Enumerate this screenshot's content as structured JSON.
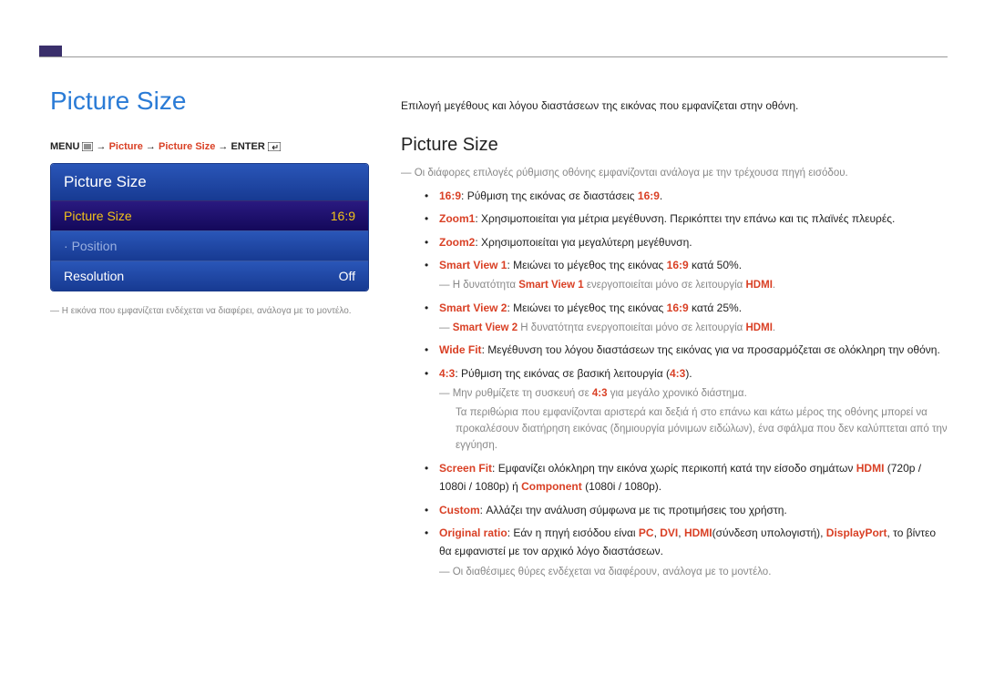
{
  "header": {
    "main_title": "Picture Size"
  },
  "nav": {
    "menu": "MENU",
    "picture": "Picture",
    "picture_size": "Picture Size",
    "enter": "ENTER"
  },
  "osd": {
    "title": "Picture Size",
    "rows": [
      {
        "label": "Picture Size",
        "value": "16:9",
        "selected": true
      },
      {
        "label": "Position",
        "value": "",
        "dot": true,
        "disabled": true
      },
      {
        "label": "Resolution",
        "value": "Off"
      }
    ]
  },
  "left_note": "Η εικόνα που εμφανίζεται ενδέχεται να διαφέρει, ανάλογα με το μοντέλο.",
  "right": {
    "intro": "Επιλογή μεγέθους και λόγου διαστάσεων της εικόνας που εμφανίζεται στην οθόνη.",
    "section_heading": "Picture Size",
    "top_note": "Οι διάφορες επιλογές ρύθμισης οθόνης εμφανίζονται ανάλογα με την τρέχουσα πηγή εισόδου.",
    "items": {
      "i0": {
        "label": "16:9",
        "text": ": Ρύθμιση της εικόνας σε διαστάσεις ",
        "tail": "16:9",
        "end": "."
      },
      "i1": {
        "label": "Zoom1",
        "text": ": Χρησιμοποιείται για μέτρια μεγέθυνση. Περικόπτει την επάνω και τις πλαϊνές πλευρές."
      },
      "i2": {
        "label": "Zoom2",
        "text": ": Χρησιμοποιείται για μεγαλύτερη μεγέθυνση."
      },
      "i3": {
        "label": "Smart View 1",
        "text": ": Μειώνει το μέγεθος της εικόνας ",
        "mid": "16:9",
        "text2": " κατά 50%."
      },
      "i3note": {
        "pre": "Η δυνατότητα ",
        "hl1": "Smart View 1",
        "mid": " ενεργοποιείται μόνο σε λειτουργία ",
        "hl2": "HDMI",
        "end": "."
      },
      "i4": {
        "label": "Smart View 2",
        "text": ": Μειώνει το μέγεθος της εικόνας ",
        "mid": "16:9",
        "text2": " κατά 25%."
      },
      "i4note": {
        "hl1": "Smart View 2",
        "mid": " Η δυνατότητα ενεργοποιείται μόνο σε λειτουργία ",
        "hl2": "HDMI",
        "end": "."
      },
      "i5": {
        "label": "Wide Fit",
        "text": ": Μεγέθυνση του λόγου διαστάσεων της εικόνας για να προσαρμόζεται σε ολόκληρη την οθόνη."
      },
      "i6": {
        "label": "4:3",
        "text": ": Ρύθμιση της εικόνας σε βασική λειτουργία (",
        "mid": "4:3",
        "end": ")."
      },
      "i6note1": {
        "pre": "Μην ρυθμίζετε τη συσκευή σε ",
        "hl": "4:3",
        "post": " για μεγάλο χρονικό διάστημα."
      },
      "i6note2": "Τα περιθώρια που εμφανίζονται αριστερά και δεξιά ή στο επάνω και κάτω μέρος της οθόνης μπορεί να προκαλέσουν διατήρηση εικόνας (δημιουργία μόνιμων ειδώλων), ένα σφάλμα που δεν καλύπτεται από την εγγύηση.",
      "i7": {
        "label": "Screen Fit",
        "text": ": Εμφανίζει ολόκληρη την εικόνα χωρίς περικοπή κατά την είσοδο σημάτων ",
        "hl1": "HDMI",
        "mid1": " (720p / 1080i / 1080p) ή ",
        "hl2": "Component",
        "end": " (1080i / 1080p)."
      },
      "i8": {
        "label": "Custom",
        "text": ": Αλλάζει την ανάλυση σύμφωνα με τις προτιμήσεις του χρήστη."
      },
      "i9": {
        "label": "Original ratio",
        "text": ": Εάν η πηγή εισόδου είναι ",
        "hl1": "PC",
        "s1": ", ",
        "hl2": "DVI",
        "s2": ", ",
        "hl3": "HDMI",
        "mid": "(σύνδεση υπολογιστή), ",
        "hl4": "DisplayPort",
        "end": ", το βίντεο θα εμφανιστεί με τον αρχικό λόγο διαστάσεων."
      },
      "i9note": "Οι διαθέσιμες θύρες ενδέχεται να διαφέρουν, ανάλογα με το μοντέλο."
    }
  }
}
